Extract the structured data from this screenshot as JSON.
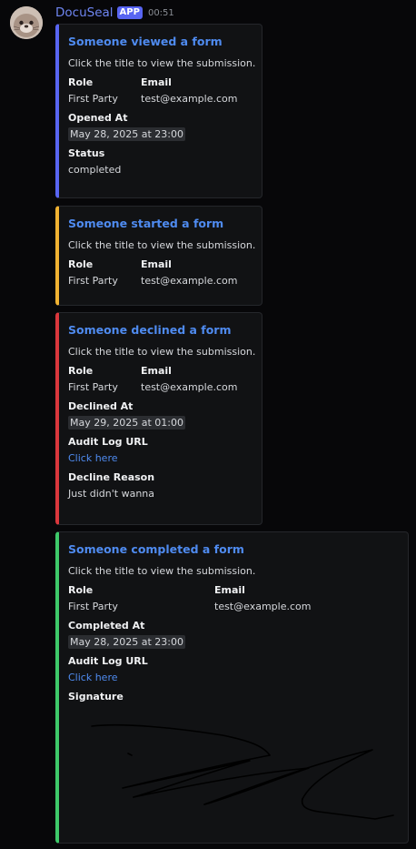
{
  "header": {
    "author": "DocuSeal",
    "badge": "APP",
    "time": "00:51"
  },
  "embeds": [
    {
      "title": "Someone viewed a form",
      "description": "Click the title to view the submission.",
      "role_label": "Role",
      "role_value": "First Party",
      "email_label": "Email",
      "email_value": "test@example.com",
      "date_label": "Opened At",
      "date_value": "May 28, 2025 at 23:00",
      "status_label": "Status",
      "status_value": "completed",
      "accent": "#5865f2"
    },
    {
      "title": "Someone started a form",
      "description": "Click the title to view the submission.",
      "role_label": "Role",
      "role_value": "First Party",
      "email_label": "Email",
      "email_value": "test@example.com",
      "accent": "#f0b232"
    },
    {
      "title": "Someone declined a form",
      "description": "Click the title to view the submission.",
      "role_label": "Role",
      "role_value": "First Party",
      "email_label": "Email",
      "email_value": "test@example.com",
      "date_label": "Declined At",
      "date_value": "May 29, 2025 at 01:00",
      "audit_label": "Audit Log URL",
      "audit_link": "Click here",
      "reason_label": "Decline Reason",
      "reason_value": "Just didn't wanna",
      "accent": "#da373c"
    },
    {
      "title": "Someone completed a form",
      "description": "Click the title to view the submission.",
      "role_label": "Role",
      "role_value": "First Party",
      "email_label": "Email",
      "email_value": "test@example.com",
      "date_label": "Completed At",
      "date_value": "May 28, 2025 at 23:00",
      "audit_label": "Audit Log URL",
      "audit_link": "Click here",
      "signature_label": "Signature",
      "accent": "#3ec96a"
    }
  ]
}
